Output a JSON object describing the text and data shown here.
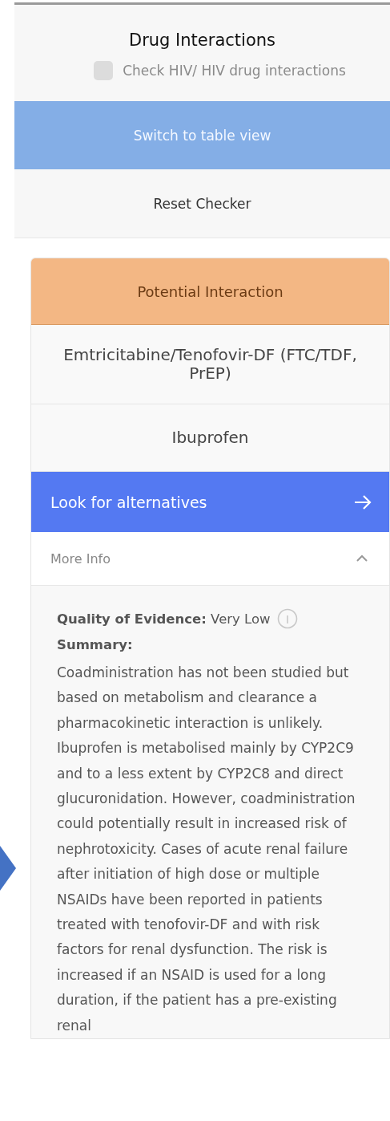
{
  "header": {
    "title": "Drug Interactions",
    "hiv_check": {
      "label": "Check HIV/ HIV drug interactions",
      "checked": false
    }
  },
  "buttons": [
    {
      "label": "Switch to table view",
      "kind": "primary"
    },
    {
      "label": "Reset Checker",
      "kind": "plain"
    }
  ],
  "interaction": {
    "status": "Potential Interaction",
    "color": "#f3b784",
    "drugs": [
      "Emtricitabine/Tenofovir-DF (FTC/TDF, PrEP)",
      "Ibuprofen"
    ],
    "action": "Look for alternatives",
    "more_info": {
      "label": "More Info",
      "expanded": true,
      "quality": "**Quality of Evidence:** Very Low",
      "summary_heading": "Summary:",
      "summary": "Coadministration has not been studied but based on metabolism and clearance a pharmacokinetic interaction is unlikely. Ibuprofen is metabolised mainly by CYP2C9 and to a less extent by CYP2C8 and direct glucuronidation. However, coadministration could potentially result in increased risk of nephrotoxicity. Cases of acute renal failure after initiation of high dose or multiple NSAIDs have been reported in patients treated with tenofovir-DF and with risk factors for renal dysfunction. The risk is increased if an NSAID is used for a long duration, if the patient has a pre-existing renal"
    }
  }
}
